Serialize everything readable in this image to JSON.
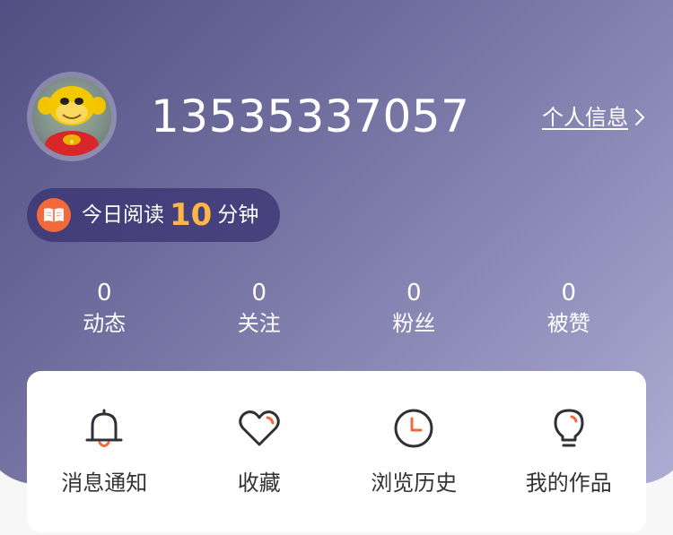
{
  "profile": {
    "phone": "13535337057",
    "info_link_label": "个人信息",
    "avatar_icon": "monkey-plush-avatar"
  },
  "reading": {
    "prefix": "今日阅读",
    "minutes": "10",
    "suffix": "分钟",
    "icon": "book-icon"
  },
  "stats": [
    {
      "value": "0",
      "label": "动态"
    },
    {
      "value": "0",
      "label": "关注"
    },
    {
      "value": "0",
      "label": "粉丝"
    },
    {
      "value": "0",
      "label": "被赞"
    }
  ],
  "menu": [
    {
      "label": "消息通知",
      "icon": "bell-icon"
    },
    {
      "label": "收藏",
      "icon": "heart-icon"
    },
    {
      "label": "浏览历史",
      "icon": "clock-icon"
    },
    {
      "label": "我的作品",
      "icon": "lightbulb-icon"
    }
  ],
  "colors": {
    "accent": "#f26a3a",
    "reading_number": "#ffb547",
    "icon_stroke": "#2f3137"
  }
}
